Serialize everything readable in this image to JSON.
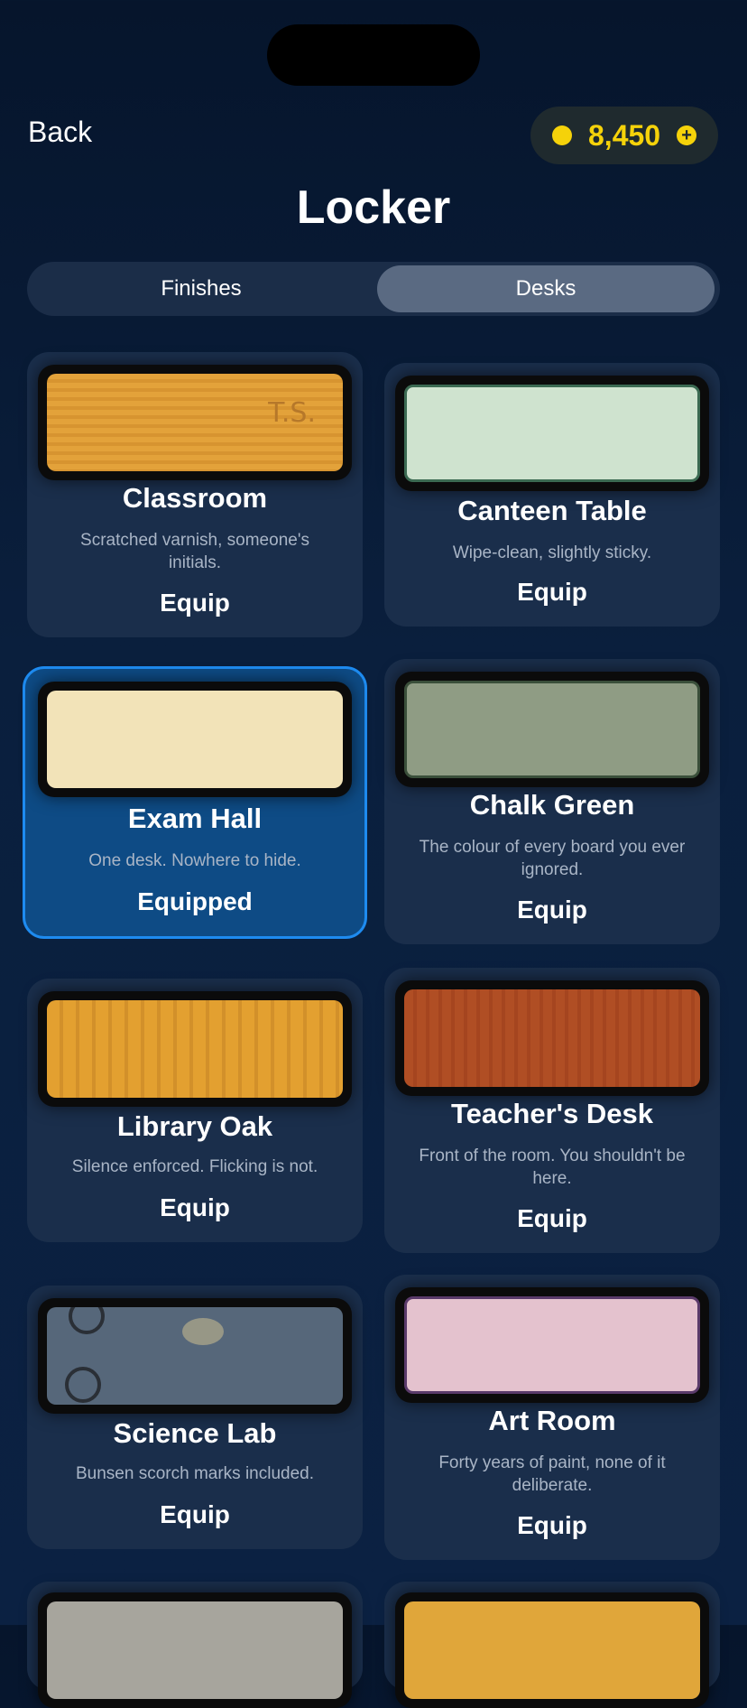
{
  "header": {
    "back_label": "Back",
    "coins": "8,450",
    "title": "Locker"
  },
  "tabs": [
    {
      "label": "Finishes",
      "selected": false
    },
    {
      "label": "Desks",
      "selected": true
    }
  ],
  "desks": [
    {
      "name": "Classroom",
      "desc": "Scratched varnish, someone's initials.",
      "action": "Equip",
      "swatch_text": "T.S.",
      "color": "#e3a23a"
    },
    {
      "name": "Canteen Table",
      "desc": "Wipe-clean, slightly sticky.",
      "action": "Equip",
      "color": "#cfe3cf"
    },
    {
      "name": "Exam Hall",
      "desc": "One desk. Nowhere to hide.",
      "action": "Equipped",
      "color": "#f2e3b8"
    },
    {
      "name": "Chalk Green",
      "desc": "The colour of every board you ever ignored.",
      "action": "Equip",
      "color": "#8f9c84"
    },
    {
      "name": "Library Oak",
      "desc": "Silence enforced. Flicking is not.",
      "action": "Equip",
      "color": "#e3a030"
    },
    {
      "name": "Teacher's Desk",
      "desc": "Front of the room. You shouldn't be here.",
      "action": "Equip",
      "color": "#b04e24"
    },
    {
      "name": "Science Lab",
      "desc": "Bunsen scorch marks included.",
      "action": "Equip",
      "color": "#56677a"
    },
    {
      "name": "Art Room",
      "desc": "Forty years of paint, none of it deliberate.",
      "action": "Equip",
      "color": "#e4c2ce"
    }
  ]
}
